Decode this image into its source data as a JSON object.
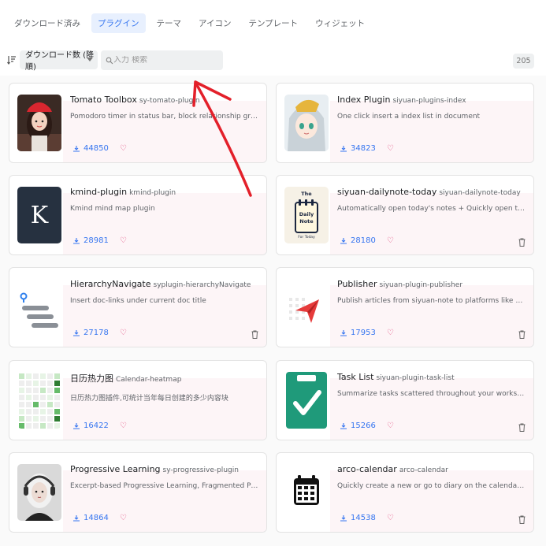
{
  "tabs": [
    {
      "label": "ダウンロード済み",
      "active": false
    },
    {
      "label": "プラグイン",
      "active": true
    },
    {
      "label": "テーマ",
      "active": false
    },
    {
      "label": "アイコン",
      "active": false
    },
    {
      "label": "テンプレート",
      "active": false
    },
    {
      "label": "ウィジェット",
      "active": false
    }
  ],
  "toolbar": {
    "sort_label": "ダウンロード数 (降順)",
    "search_placeholder": "入力 検索",
    "total_count": "205"
  },
  "colors": {
    "accent": "#3575f0",
    "heart": "#e24a7d",
    "annotation_arrow": "#e3202a"
  },
  "plugins": [
    {
      "title": "Tomato Toolbox",
      "package": "sy-tomato-plugin",
      "description": "Pomodoro timer in status bar, block relationship graph...",
      "downloads": "44850",
      "thumb": "girl-red-hat-avatar",
      "trash": false
    },
    {
      "title": "Index Plugin",
      "package": "siyuan-plugins-index",
      "description": "One click insert a index list in document",
      "downloads": "34823",
      "thumb": "anime-girl-avatar",
      "trash": false
    },
    {
      "title": "kmind-plugin",
      "package": "kmind-plugin",
      "description": "Kmind mind map plugin",
      "downloads": "28981",
      "thumb": "letter-k-icon",
      "thumb_text": "K",
      "trash": false
    },
    {
      "title": "siyuan-dailynote-today",
      "package": "siyuan-dailynote-today",
      "description": "Automatically open today's notes + Quickly open toda...",
      "downloads": "28180",
      "thumb": "daily-note-icon",
      "thumb_text_top": "The",
      "thumb_text_mid": "Daily",
      "thumb_text_mid2": "Note",
      "thumb_text_bottom": "For Today",
      "trash": true
    },
    {
      "title": "HierarchyNavigate",
      "package": "syplugin-hierarchyNavigate",
      "description": "Insert doc-links under current doc title",
      "downloads": "27178",
      "thumb": "hierarchy-icon",
      "trash": true
    },
    {
      "title": "Publisher",
      "package": "siyuan-plugin-publisher",
      "description": "Publish articles from siyuan-note to platforms like Yuqu...",
      "downloads": "17953",
      "thumb": "paper-plane-icon",
      "trash": true
    },
    {
      "title": "日历热力图",
      "package": "Calendar-heatmap",
      "description": "日历热力图插件,可统计当年每日创建的多少内容块",
      "downloads": "16422",
      "thumb": "heatmap-icon",
      "trash": false
    },
    {
      "title": "Task List",
      "package": "siyuan-plugin-task-list",
      "description": "Summarize tasks scattered throughout your workspac...",
      "downloads": "15266",
      "thumb": "clipboard-check-icon",
      "trash": true
    },
    {
      "title": "Progressive Learning",
      "package": "sy-progressive-plugin",
      "description": "Excerpt-based Progressive Learning, Fragmented Progr...",
      "downloads": "14864",
      "thumb": "girl-headphones-avatar",
      "trash": false
    },
    {
      "title": "arco-calendar",
      "package": "arco-calendar",
      "description": "Quickly create a new or go to diary on the calendar pa...",
      "downloads": "14538",
      "thumb": "calendar-icon",
      "trash": true
    }
  ]
}
